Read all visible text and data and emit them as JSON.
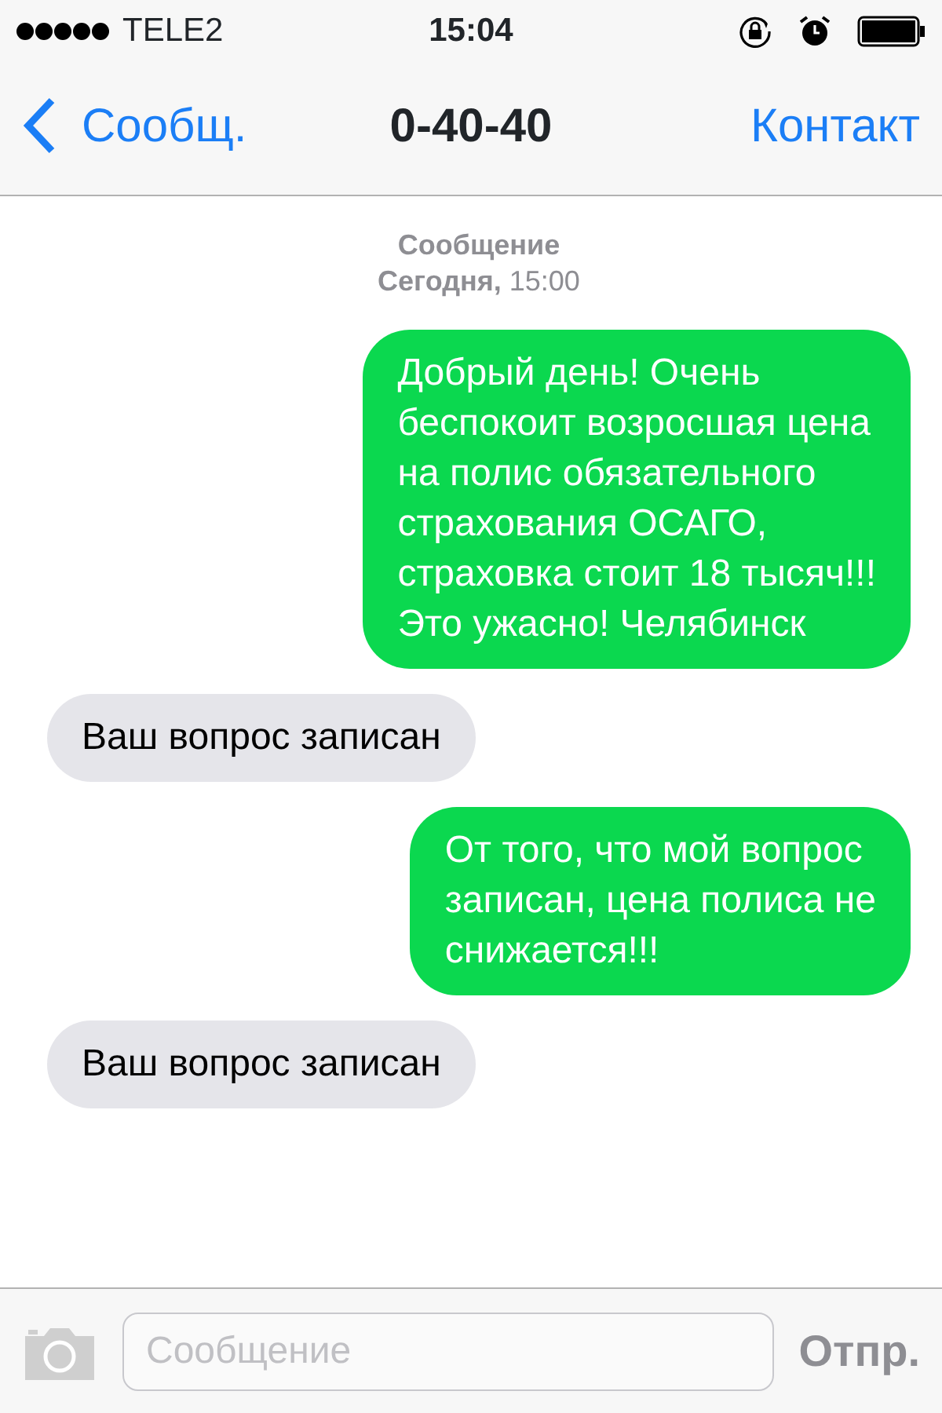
{
  "status_bar": {
    "carrier": "TELE2",
    "time": "15:04"
  },
  "nav": {
    "back": "Сообщ.",
    "title": "0-40-40",
    "action": "Контакт"
  },
  "thread_header": {
    "label": "Сообщение",
    "date": "**Сегодня,** 15:00"
  },
  "messages": [
    {
      "kind": "sent",
      "text": "Добрый день! Очень\nбеспокоит возросшая цена\nна полис обязательного\nстрахования ОСАГО,\nстраховка стоит 18 тысяч!!!\nЭто ужасно! Челябинск"
    },
    {
      "kind": "received",
      "text": "Ваш вопрос записан"
    },
    {
      "kind": "sent",
      "text": "От того, что мой вопрос\nзаписан, цена полиса не\nснижается!!!"
    },
    {
      "kind": "received",
      "text": "Ваш вопрос записан"
    }
  ],
  "composer": {
    "placeholder": "Сообщение",
    "send": "Отпр.",
    "send_disabled": true
  }
}
